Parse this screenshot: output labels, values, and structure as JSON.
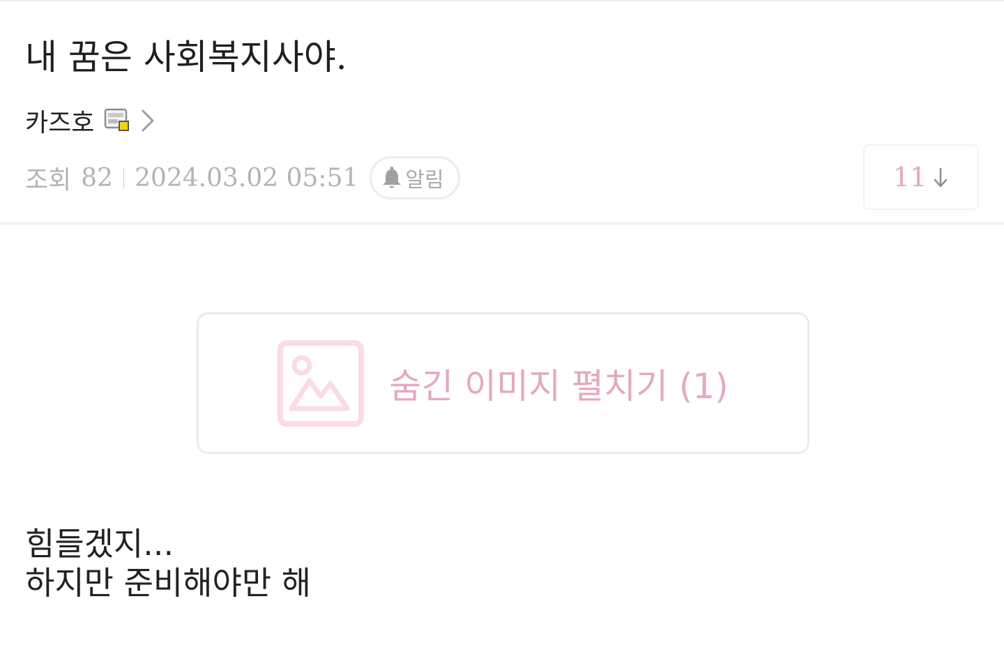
{
  "post": {
    "title": "내 꿈은 사회복지사야.",
    "author": "카즈호",
    "views_label": "조회",
    "views": "82",
    "datetime": "2024.03.02 05:51",
    "alarm_label": "알림",
    "vote_count": "11"
  },
  "hidden_image": {
    "label": "숨긴 이미지 펼치기 (1)"
  },
  "body": {
    "lines": [
      "힘들겠지...",
      "하지만 준비해야만 해"
    ]
  },
  "colors": {
    "accent_pink": "#e5a8c1",
    "meta_gray": "#b3b3b3",
    "border_gray": "#ebebeb"
  },
  "icons": [
    "level-badge-icon",
    "chevron-right-icon",
    "bell-icon",
    "arrow-down-icon",
    "image-icon"
  ]
}
